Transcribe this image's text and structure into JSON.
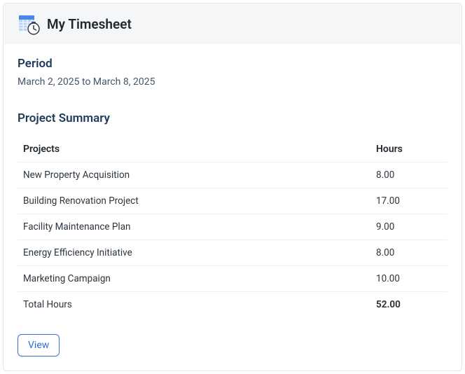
{
  "header": {
    "title": "My Timesheet"
  },
  "period": {
    "label": "Period",
    "text": "March 2, 2025 to March 8, 2025"
  },
  "summary": {
    "title": "Project Summary",
    "columns": {
      "projects": "Projects",
      "hours": "Hours"
    },
    "rows": [
      {
        "project": "New Property Acquisition",
        "hours": "8.00"
      },
      {
        "project": "Building Renovation Project",
        "hours": "17.00"
      },
      {
        "project": "Facility Maintenance Plan",
        "hours": "9.00"
      },
      {
        "project": "Energy Efficiency Initiative",
        "hours": "8.00"
      },
      {
        "project": "Marketing Campaign",
        "hours": "10.00"
      }
    ],
    "total": {
      "label": "Total Hours",
      "hours": "52.00"
    }
  },
  "actions": {
    "view": "View"
  }
}
